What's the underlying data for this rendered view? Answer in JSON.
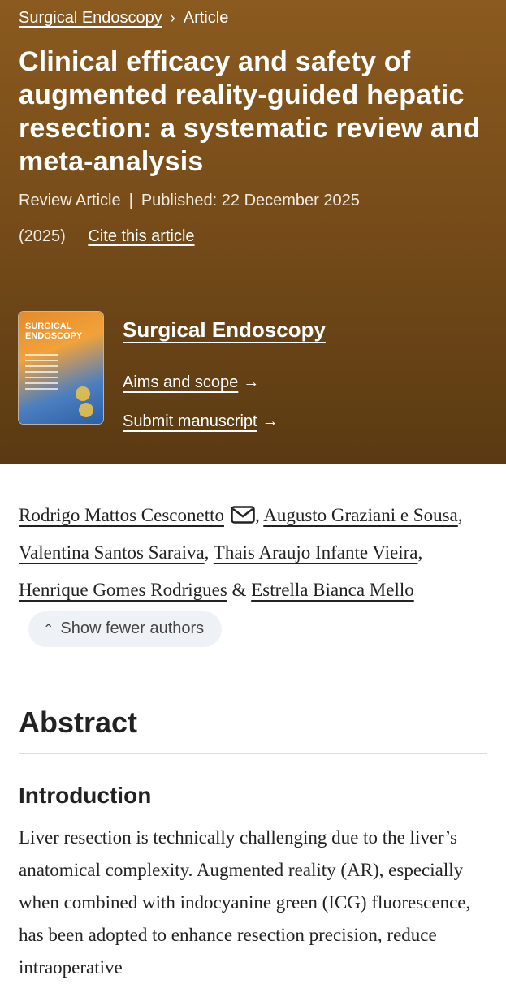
{
  "breadcrumb": {
    "journal": "Surgical Endoscopy",
    "current": "Article"
  },
  "article": {
    "title": "Clinical efficacy and safety of augmented reality-guided hepatic resection: a systematic review and meta-analysis",
    "type": "Review Article",
    "published": "Published: 22 December 2025",
    "year": "(2025)",
    "cite_label": "Cite this article"
  },
  "journal": {
    "name": "Surgical Endoscopy",
    "cover_title": "SURGICAL ENDOSCOPY",
    "aims_label": "Aims and scope",
    "submit_label": "Submit manuscript",
    "cover_icon": "journal-cover-image"
  },
  "authors": {
    "list": [
      "Rodrigo Mattos Cesconetto",
      "Augusto Graziani e Sousa",
      "Valentina Santos Saraiva",
      "Thais Araujo Infante Vieira",
      "Henrique Gomes Rodrigues",
      "Estrella Bianca Mello"
    ],
    "toggle_label": "Show fewer authors"
  },
  "abstract": {
    "heading": "Abstract",
    "section_heading": "Introduction",
    "text": "Liver resection is technically challenging due to the liver’s anatomical complexity. Augmented reality (AR), especially when combined with indocyanine green (ICG) fluorescence, has been adopted to enhance resection precision, reduce intraoperative"
  },
  "colors": {
    "hero_top": "#8a5a1f",
    "hero_bottom": "#5a3a12",
    "pill_bg": "#eef1f6"
  }
}
